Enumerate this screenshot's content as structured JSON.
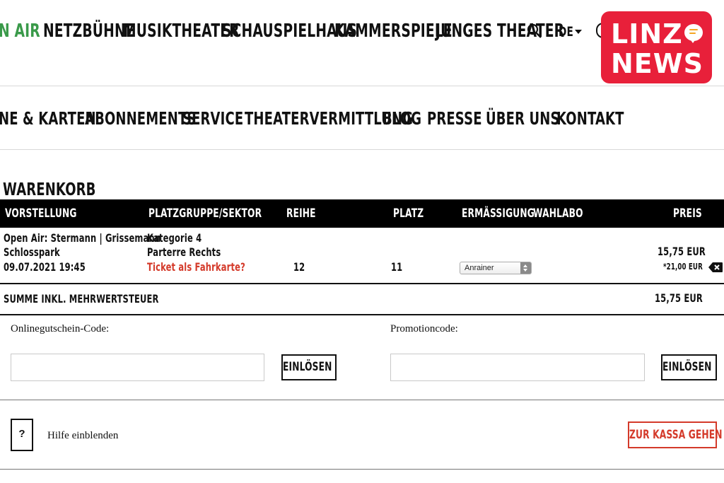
{
  "top_nav": {
    "items": [
      "N AIR",
      "NETZBÜHNE",
      "MUSIKTHEATER",
      "SCHAUSPIELHAUS",
      "KAMMERSPIELE",
      "JUNGES THEATER"
    ],
    "language": "DE"
  },
  "logo": {
    "line1": "LINZ",
    "line2": "NEWS",
    "color": "#e8203a"
  },
  "sub_nav": {
    "items": [
      "NE & KARTEN",
      "ABONNEMENTS",
      "SERVICE",
      "THEATERVERMITTLUNG",
      "BLOG",
      "PRESSE",
      "ÜBER UNS",
      "KONTAKT"
    ]
  },
  "cart": {
    "title": "WARENKORB",
    "headers": {
      "show": "VORSTELLUNG",
      "seat_group": "PLATZGRUPPE/SEKTOR",
      "row": "REIHE",
      "seat": "PLATZ",
      "discount": "ERMÄSSIGUNG",
      "choice": "WAHLABO",
      "price": "PREIS"
    },
    "item": {
      "show_title": "Open Air: Stermann | Grissemann",
      "venue": "Schlosspark",
      "datetime": "09.07.2021 19:45",
      "category": "Kategorie 4",
      "section": "Parterre Rechts",
      "ticket_link": "Ticket als Fahrkarte?",
      "row": "12",
      "seat": "11",
      "discount_selected": "Anrainer",
      "price": "15,75  EUR",
      "original_price": "*21,00 EUR"
    },
    "sum_label": "SUMME INKL. MEHRWERTSTEUER",
    "sum_value": "15,75  EUR"
  },
  "vouchers": {
    "online_label": "Onlinegutschein-Code:",
    "online_value": "",
    "promo_label": "Promotioncode:",
    "promo_value": "",
    "redeem_label": "EINLÖSEN"
  },
  "footer": {
    "help_symbol": "?",
    "help_text": "Hilfe einblenden",
    "checkout_label": "ZUR KASSA GEHEN",
    "accent": "#d43a2a"
  }
}
